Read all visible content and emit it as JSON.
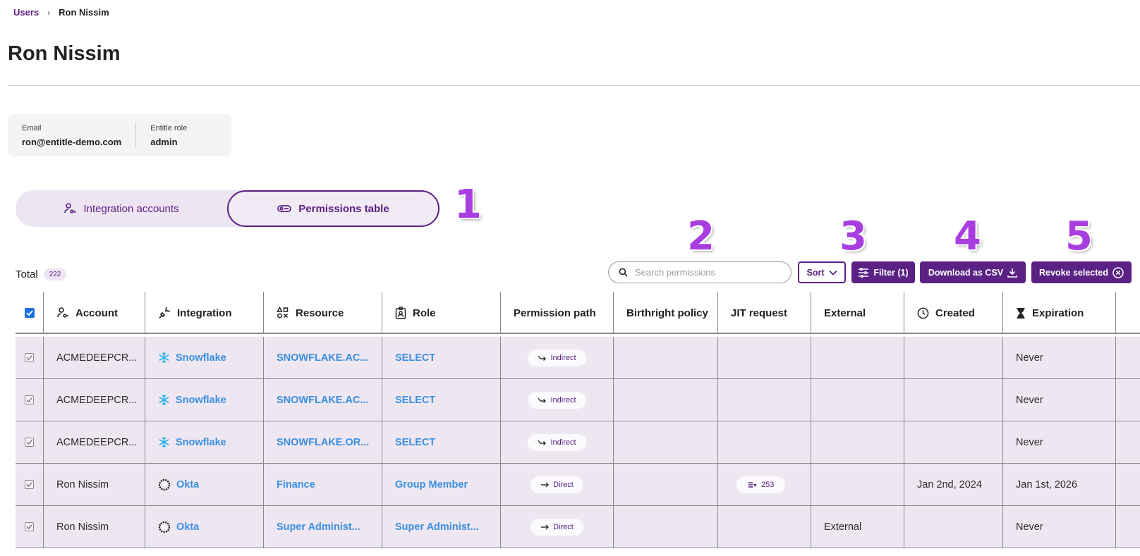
{
  "breadcrumb": {
    "parent": "Users",
    "separator": "›",
    "current": "Ron Nissim"
  },
  "page": {
    "title": "Ron Nissim"
  },
  "user_info": {
    "email_label": "Email",
    "email": "ron@entitle-demo.com",
    "role_label": "Entitle role",
    "role": "admin"
  },
  "tabs": [
    {
      "label": "Integration accounts",
      "active": false
    },
    {
      "label": "Permissions table",
      "active": true
    }
  ],
  "annotations": [
    "1",
    "2",
    "3",
    "4",
    "5"
  ],
  "toolbar": {
    "total_label": "Total",
    "total_count": "222",
    "search_placeholder": "Search permissions",
    "sort_label": "Sort",
    "filter_label": "Filter (1)",
    "csv_label": "Download as CSV",
    "revoke_label": "Revoke selected"
  },
  "columns": [
    "Account",
    "Integration",
    "Resource",
    "Role",
    "Permission path",
    "Birthright policy",
    "JIT request",
    "External",
    "Created",
    "Expiration"
  ],
  "rows": [
    {
      "account": "ACMEDEEPCR...",
      "integration": "Snowflake",
      "integration_icon": "snowflake-icon",
      "resource": "SNOWFLAKE.AC...",
      "role": "SELECT",
      "path": "Indirect",
      "birthright": "",
      "jit": "",
      "external": "",
      "created": "",
      "expiration": "Never"
    },
    {
      "account": "ACMEDEEPCR...",
      "integration": "Snowflake",
      "integration_icon": "snowflake-icon",
      "resource": "SNOWFLAKE.AC...",
      "role": "SELECT",
      "path": "Indirect",
      "birthright": "",
      "jit": "",
      "external": "",
      "created": "",
      "expiration": "Never"
    },
    {
      "account": "ACMEDEEPCR...",
      "integration": "Snowflake",
      "integration_icon": "snowflake-icon",
      "resource": "SNOWFLAKE.OR...",
      "role": "SELECT",
      "path": "Indirect",
      "birthright": "",
      "jit": "",
      "external": "",
      "created": "",
      "expiration": "Never"
    },
    {
      "account": "Ron Nissim",
      "integration": "Okta",
      "integration_icon": "okta-icon",
      "resource": "Finance",
      "role": "Group Member",
      "path": "Direct",
      "birthright": "",
      "jit": "253",
      "external": "",
      "created": "Jan 2nd, 2024",
      "expiration": "Jan 1st, 2026"
    },
    {
      "account": "Ron Nissim",
      "integration": "Okta",
      "integration_icon": "okta-icon",
      "resource": "Super Administ...",
      "role": "Super Administ...",
      "path": "Direct",
      "birthright": "",
      "jit": "",
      "external": "External",
      "created": "",
      "expiration": "Never"
    }
  ],
  "colors": {
    "brand": "#5b2184",
    "link": "#3b8ee0",
    "annotation": "#a83ee0",
    "row_bg": "#eee7f2"
  }
}
